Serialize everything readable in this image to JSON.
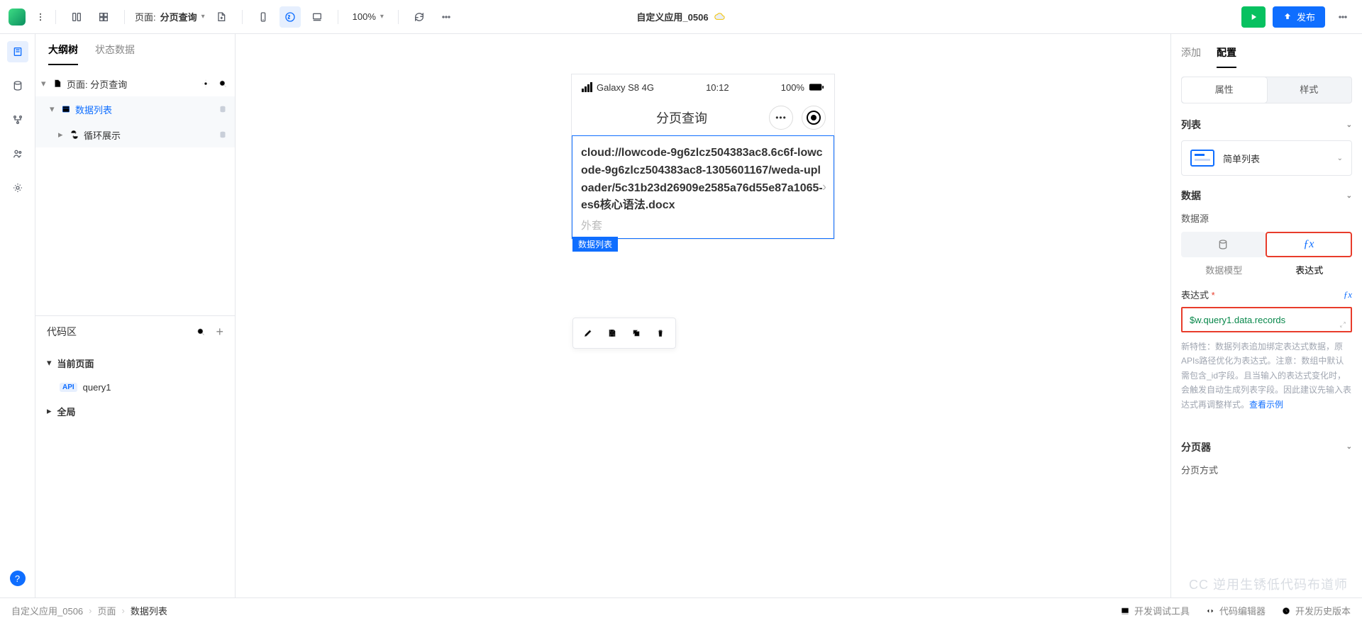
{
  "top": {
    "page_prefix": "页面:",
    "page_name": "分页查询",
    "zoom": "100%",
    "app_title": "自定义应用_0506",
    "publish": "发布"
  },
  "left": {
    "tabs": [
      "大纲树",
      "状态数据"
    ],
    "page_row": "页面: 分页查询",
    "datalist": "数据列表",
    "loop": "循环展示",
    "code_hd": "代码区",
    "cur_page": "当前页面",
    "query": "query1",
    "global": "全局"
  },
  "device": {
    "carrier": "Galaxy S8  4G",
    "time": "10:12",
    "battery": "100%",
    "hdr_title": "分页查询",
    "item_text": "cloud://lowcode-9g6zlcz504383ac8.6c6f-lowcode-9g6zlcz504383ac8-1305601167/weda-uploader/5c31b23d26909e2585a76d55e87a1065-es6核心语法.docx",
    "item_sub": "外套",
    "sel_tag": "数据列表"
  },
  "right": {
    "tabs": [
      "添加",
      "配置"
    ],
    "seg": [
      "属性",
      "样式"
    ],
    "sec_list": "列表",
    "card_title": "简单列表",
    "sec_data": "数据",
    "ds_label": "数据源",
    "ds_model": "数据模型",
    "ds_expr": "表达式",
    "expr_label": "表达式",
    "expr_value": "$w.query1.data.records",
    "hint": "新特性：数据列表追加绑定表达式数据，原APIs路径优化为表达式。注意：数组中默认需包含_id字段。且当输入的表达式变化时，会触发自动生成列表字段。因此建议先输入表达式再调整样式。",
    "hint_link": "查看示例",
    "sec_pager": "分页器",
    "pager_mode": "分页方式"
  },
  "bottom": {
    "crumb": [
      "自定义应用_0506",
      "页面",
      "数据列表"
    ],
    "debug": "开发调试工具",
    "editor": "代码编辑器",
    "history": "开发历史版本",
    "brand": "CC 逆用生锈低代码布道师"
  }
}
